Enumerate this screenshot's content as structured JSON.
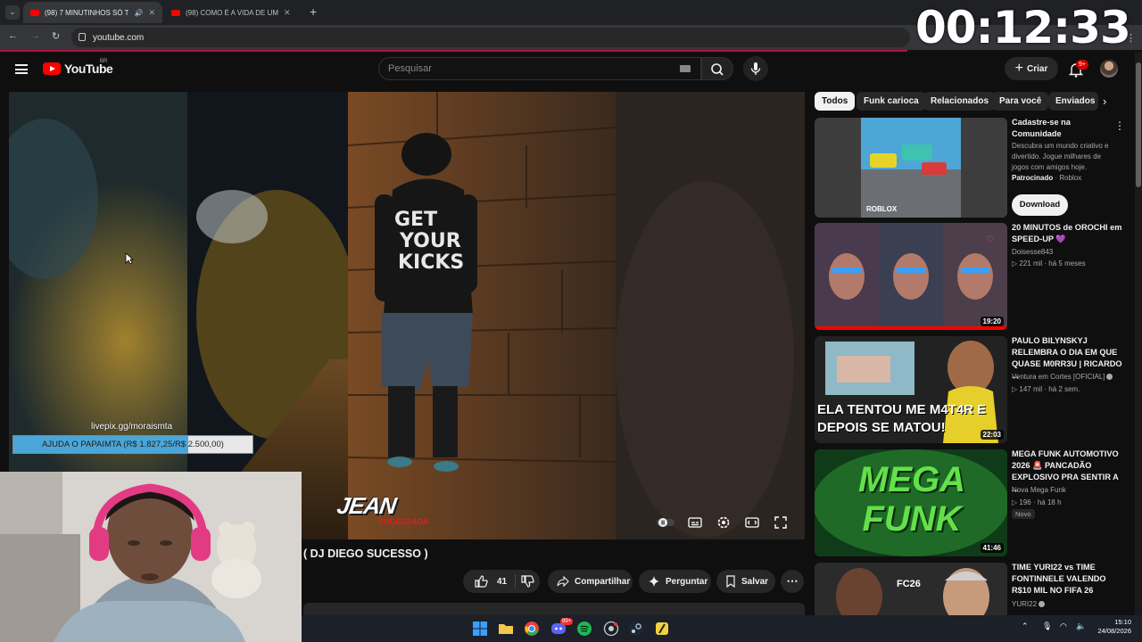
{
  "browser": {
    "tabs": [
      {
        "title": "(98) 7 MINUTINHOS SÓ TA...",
        "active": true
      },
      {
        "title": "(98) COMO É A VIDA DE UM C...",
        "active": false
      }
    ],
    "new_tab": "+",
    "url": "youtube.com"
  },
  "stream_timer": "00:12:33",
  "youtube": {
    "logo_word": "YouTube",
    "region": "BR",
    "search_placeholder": "Pesquisar",
    "create_label": "Criar",
    "notification_count": "9+"
  },
  "video": {
    "watermark": "JEAN",
    "watermark_sub": "SUCESSADA",
    "title": "( DJ DIEGO SUCESSO )",
    "like_count": "41",
    "share_label": "Compartilhar",
    "ask_label": "Perguntar",
    "save_label": "Salvar"
  },
  "donation": {
    "url": "livepix.gg/moraismta",
    "goal_text": "AJUDA O PAPAIMTA (R$ 1.827,25/R$ 2.500,00)",
    "progress": 0.731
  },
  "chips": [
    "Todos",
    "Funk carioca",
    "Relacionados",
    "Para você",
    "Enviados"
  ],
  "ad": {
    "title": "Cadastre-se na Comunidade",
    "description": "Descubra um mundo criativo e divertido. Jogue milhares de jogos com amigos hoje.",
    "sponsored": "Patrocinado",
    "advertiser": "Roblox",
    "thumb_label": "ROBLOX",
    "cta": "Download"
  },
  "recommendations": [
    {
      "title": "20 MINUTOS de OROCHI em SPEED-UP 💜",
      "channel": "Doisesse843",
      "views": "221 mil",
      "age": "há 5 meses",
      "duration": "19:20",
      "verified": false,
      "badge": "",
      "thumb_text": ""
    },
    {
      "title": "PAULO BILYNSKYJ RELEMBRA O DIA EM QUE QUASE M0RR3U | RICARDO ...",
      "channel": "Ventura em Cortes [OFICIAL]",
      "views": "147 mil",
      "age": "há 2 sem.",
      "duration": "22:03",
      "verified": true,
      "badge": "",
      "thumb_text": "ELA TENTOU ME M4T4R E DEPOIS SE MATOU!"
    },
    {
      "title": "MEGA FUNK AUTOMOTIVO 2026 🚨 PANCADÃO EXPLOSIVO PRA SENTIR A ...",
      "channel": "Nova Mega Funk",
      "views": "196",
      "age": "há 18 h",
      "duration": "41:46",
      "verified": false,
      "badge": "Novo",
      "thumb_text": "MEGA FUNK"
    },
    {
      "title": "TIME YURI22 vs TIME FONTINNELE VALENDO R$10 MIL NO FIFA 26",
      "channel": "YURI22",
      "views": "",
      "age": "",
      "duration": "",
      "verified": true,
      "badge": "",
      "thumb_text": "FC26"
    }
  ],
  "taskbar": {
    "time": "15:10",
    "date": "24/08/2026",
    "discord_badge": "99+"
  },
  "colors": {
    "youtube_red": "#ff0000",
    "progress_blue": "#4aa6d8",
    "page_bg": "#0f0f0f"
  }
}
